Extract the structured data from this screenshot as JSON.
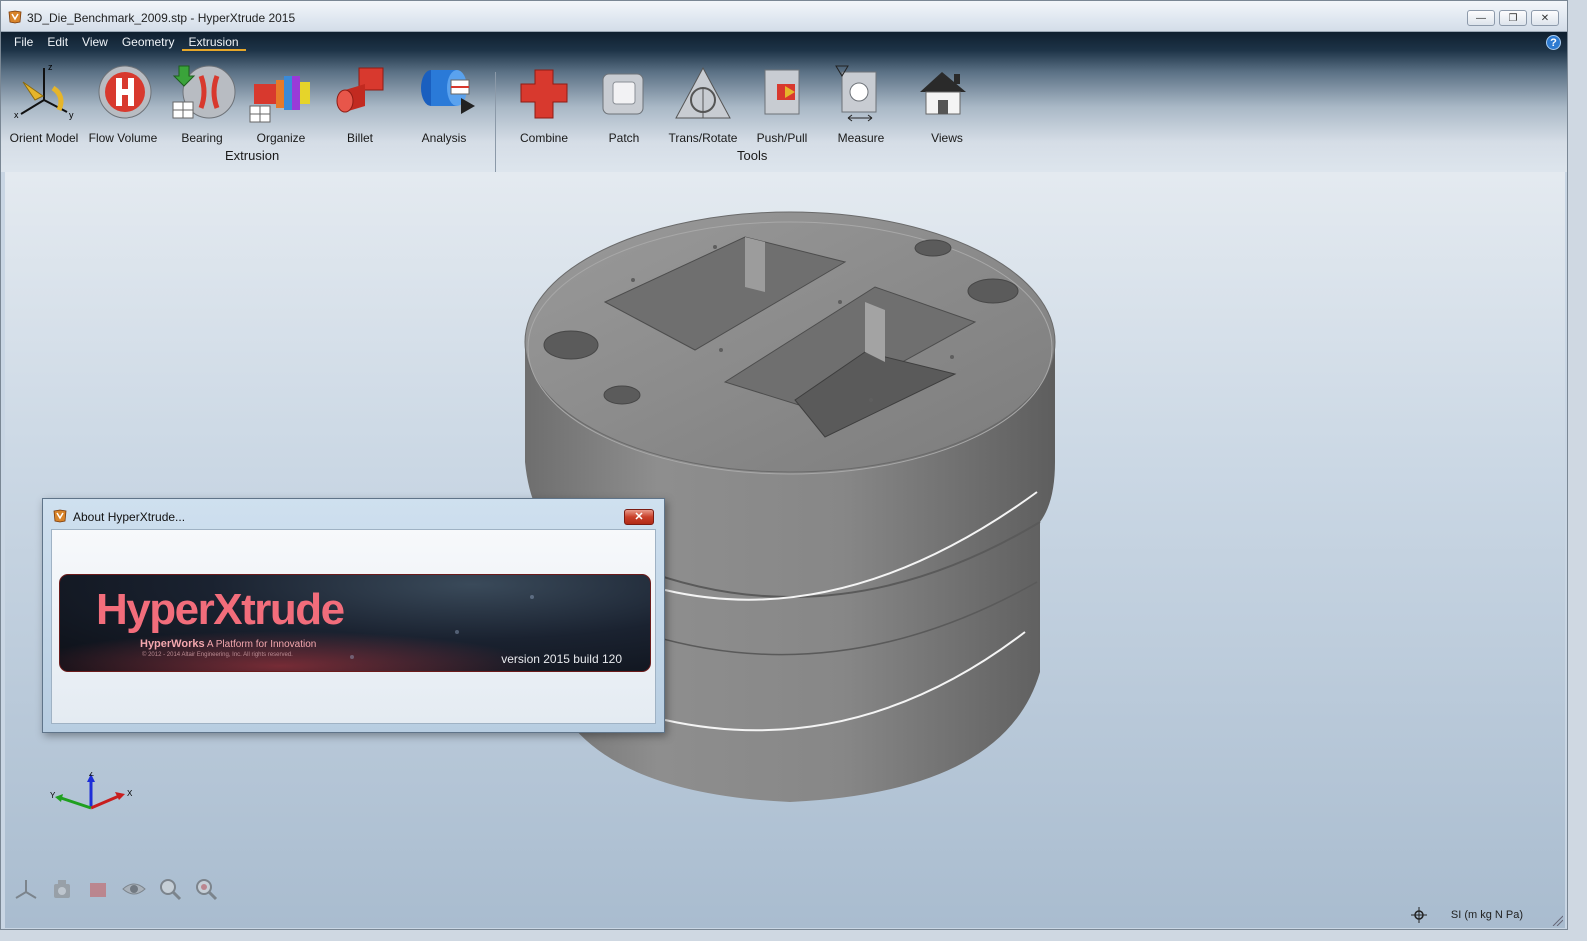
{
  "window": {
    "title": "3D_Die_Benchmark_2009.stp - HyperXtrude 2015",
    "buttons": [
      "minimize-icon",
      "restore-icon",
      "close-icon"
    ]
  },
  "menubar": {
    "items": [
      "File",
      "Edit",
      "View",
      "Geometry",
      "Extrusion"
    ],
    "active": "Extrusion"
  },
  "ribbon": {
    "groups": [
      {
        "label": "Extrusion",
        "tools": [
          "Orient Model",
          "Flow Volume",
          "Bearing",
          "Organize",
          "Billet",
          "Analysis"
        ]
      },
      {
        "label": "Tools",
        "tools": [
          "Combine",
          "Patch",
          "Trans/Rotate",
          "Push/Pull",
          "Measure",
          "Views"
        ]
      }
    ]
  },
  "about_dialog": {
    "title": "About HyperXtrude...",
    "logo": "HyperXtrude",
    "tagline_brand": "HyperWorks",
    "tagline": "A Platform for Innovation",
    "copyright": "© 2012 - 2014 Altair Engineering, Inc. All rights reserved.",
    "version": "version 2015 build 120"
  },
  "triad": {
    "x": "X",
    "y": "Y",
    "z": "Z"
  },
  "status": {
    "units": "SI (m kg N Pa)"
  },
  "colors": {
    "accent": "#e6a72a",
    "logo": "#f26d7b",
    "model": "#8a8a8a"
  }
}
